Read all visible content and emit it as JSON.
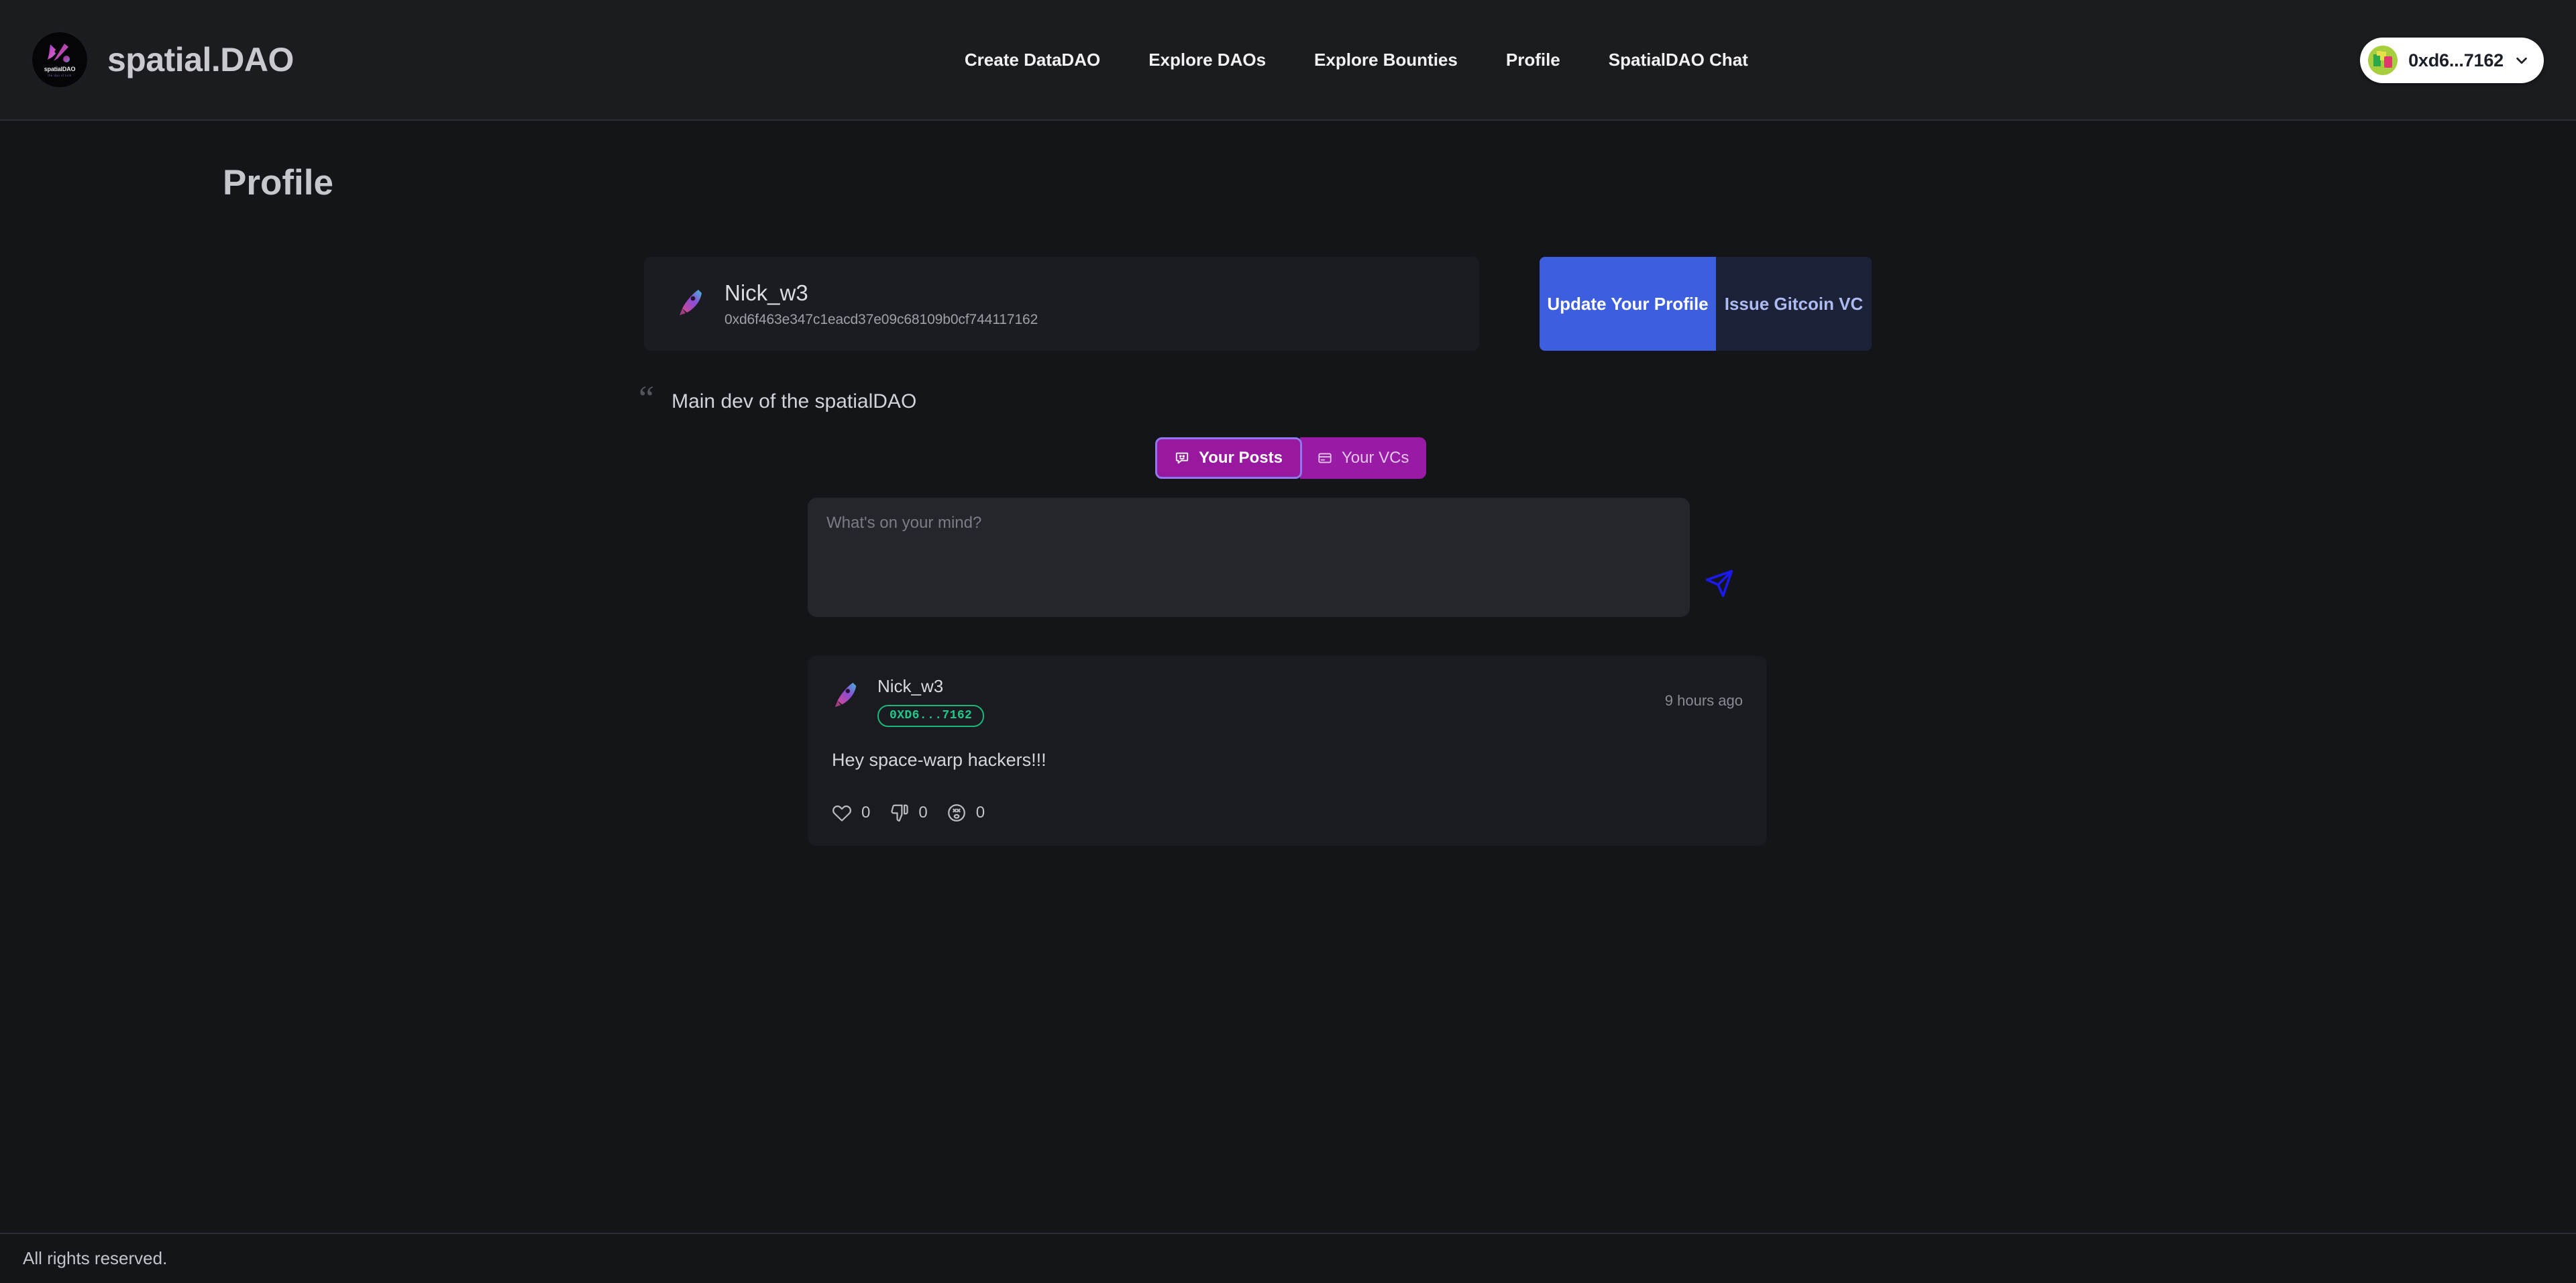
{
  "header": {
    "brand_title": "spatial.DAO",
    "logo_word": "spatialDAO",
    "logo_sub": "the dao of luck",
    "nav": [
      {
        "label": "Create DataDAO"
      },
      {
        "label": "Explore DAOs"
      },
      {
        "label": "Explore Bounties"
      },
      {
        "label": "Profile"
      },
      {
        "label": "SpatialDAO Chat"
      }
    ],
    "wallet": {
      "address_short": "0xd6...7162",
      "avatar_icon": "wallet-avatar-icon",
      "chevron_icon": "chevron-down-icon"
    }
  },
  "page": {
    "title": "Profile"
  },
  "profile": {
    "avatar_icon": "rocket-icon",
    "name": "Nick_w3",
    "address": "0xd6f463e347c1eacd37e09c68109b0cf744117162",
    "bio": "Main dev of the spatialDAO",
    "quote_icon": "quote-icon",
    "actions": {
      "update_label": "Update Your Profile",
      "vc_label": "Issue Gitcoin VC"
    }
  },
  "tabs": [
    {
      "label": "Your Posts",
      "icon": "chat-smile-icon",
      "active": true
    },
    {
      "label": "Your VCs",
      "icon": "card-icon",
      "active": false
    }
  ],
  "composer": {
    "placeholder": "What's on your mind?",
    "value": "",
    "send_icon": "send-plane-icon"
  },
  "posts": [
    {
      "avatar_icon": "rocket-icon",
      "author": "Nick_w3",
      "address_badge": "0XD6...7162",
      "time": "9 hours ago",
      "body": "Hey space-warp hackers!!!",
      "reactions": [
        {
          "icon": "heart-icon",
          "count": "0"
        },
        {
          "icon": "thumbs-down-icon",
          "count": "0"
        },
        {
          "icon": "dizzy-face-icon",
          "count": "0"
        }
      ]
    }
  ],
  "footer": {
    "text": "All rights reserved."
  },
  "colors": {
    "page_bg": "#141519",
    "header_bg": "#1b1c20",
    "card_bg": "#1b1c21",
    "accent_blue": "#3d5fdf",
    "accent_navy": "#1b2238",
    "accent_purple": "#991ba5",
    "tab_border": "#8e79ee",
    "badge_green": "#1fc98a",
    "send_blue": "#1a1aee",
    "wallet_pill": "#ffffff"
  }
}
